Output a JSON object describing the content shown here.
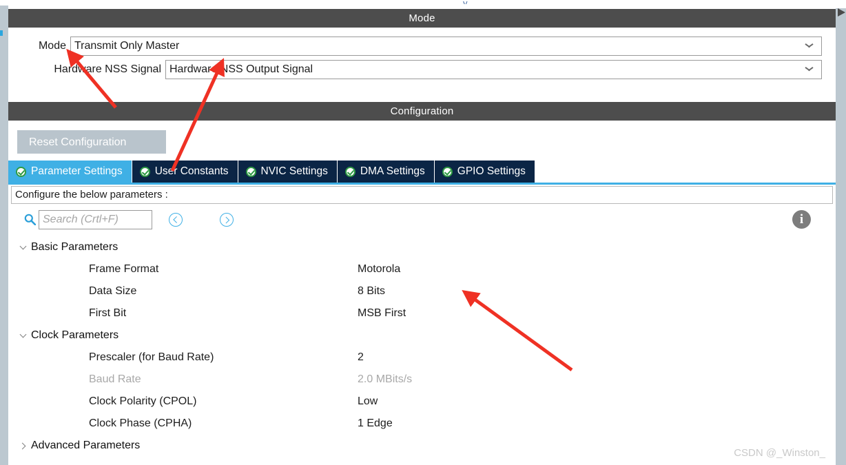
{
  "mode_panel": {
    "header": "Mode",
    "rows": [
      {
        "label": "Mode",
        "value": "Transmit Only Master",
        "icon": "chevron-down-icon"
      },
      {
        "label": "Hardware NSS Signal",
        "value": "Hardware NSS Output Signal",
        "icon": "chevron-down-icon"
      }
    ]
  },
  "config_panel": {
    "header": "Configuration",
    "reset_button": "Reset Configuration",
    "tabs": [
      {
        "label": "Parameter Settings",
        "active": true,
        "icon": "check-circle-icon"
      },
      {
        "label": "User Constants",
        "active": false,
        "icon": "check-circle-icon"
      },
      {
        "label": "NVIC Settings",
        "active": false,
        "icon": "check-circle-icon"
      },
      {
        "label": "DMA Settings",
        "active": false,
        "icon": "check-circle-icon"
      },
      {
        "label": "GPIO Settings",
        "active": false,
        "icon": "check-circle-icon"
      }
    ],
    "configure_bar": "Configure the below parameters :",
    "search": {
      "icon": "search-icon",
      "placeholder": "Search (Crtl+F)",
      "value": "",
      "prev_icon": "chevron-left-circle-icon",
      "next_icon": "chevron-right-circle-icon"
    },
    "info_icon_label": "i",
    "groups": [
      {
        "name": "Basic Parameters",
        "expanded": true,
        "params": [
          {
            "name": "Frame Format",
            "value": "Motorola",
            "disabled": false
          },
          {
            "name": "Data Size",
            "value": "8 Bits",
            "disabled": false
          },
          {
            "name": "First Bit",
            "value": "MSB First",
            "disabled": false
          }
        ]
      },
      {
        "name": "Clock Parameters",
        "expanded": true,
        "params": [
          {
            "name": "Prescaler (for Baud Rate)",
            "value": "2",
            "disabled": false
          },
          {
            "name": "Baud Rate",
            "value": "2.0 MBits/s",
            "disabled": true
          },
          {
            "name": "Clock Polarity (CPOL)",
            "value": "Low",
            "disabled": false
          },
          {
            "name": "Clock Phase (CPHA)",
            "value": "1 Edge",
            "disabled": false
          }
        ]
      },
      {
        "name": "Advanced Parameters",
        "expanded": false,
        "params": []
      }
    ]
  },
  "watermark": "CSDN @_Winston_",
  "colors": {
    "header_bar": "#4d4d4d",
    "tab_active": "#3fb0e5",
    "tab_inactive": "#0b2545",
    "accent_blue": "#3fb0e5",
    "gutter": "#bcc8d0",
    "reset_button": "#b9c4cc",
    "annotation_red": "#ef3124",
    "disabled_text": "#a8a8a8"
  }
}
